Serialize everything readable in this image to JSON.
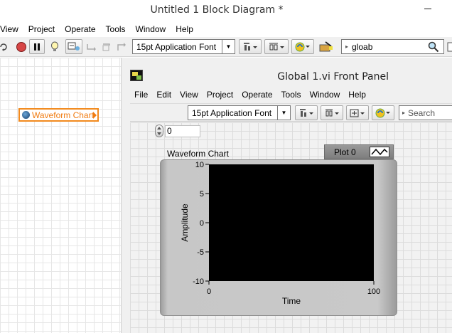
{
  "block_diagram": {
    "title": "Untitled 1 Block Diagram *",
    "menu": [
      "View",
      "Project",
      "Operate",
      "Tools",
      "Window",
      "Help"
    ],
    "toolbar": {
      "font": "15pt Application Font",
      "search_value": "gloab"
    },
    "global_node": {
      "label": "Waveform Chart"
    }
  },
  "front_panel": {
    "title": "Global 1.vi Front Panel",
    "menu": [
      "File",
      "Edit",
      "View",
      "Project",
      "Operate",
      "Tools",
      "Window",
      "Help"
    ],
    "toolbar": {
      "font": "15pt Application Font",
      "search_placeholder": "Search"
    },
    "numeric_control": {
      "value": "0"
    },
    "chart": {
      "label": "Waveform Chart",
      "legend_plot": "Plot 0"
    }
  },
  "chart_data": {
    "type": "line",
    "title": "Waveform Chart",
    "xlabel": "Time",
    "ylabel": "Amplitude",
    "xlim": [
      0,
      100
    ],
    "ylim": [
      -10,
      10
    ],
    "x_ticks": [
      "0",
      "100"
    ],
    "y_ticks": [
      "10",
      "5",
      "0",
      "-5",
      "-10"
    ],
    "series": [
      {
        "name": "Plot 0",
        "values": []
      }
    ],
    "plot_background": "#000000",
    "grid": false
  },
  "colors": {
    "global_node": "#f07c12",
    "plot_area": "#000000"
  }
}
